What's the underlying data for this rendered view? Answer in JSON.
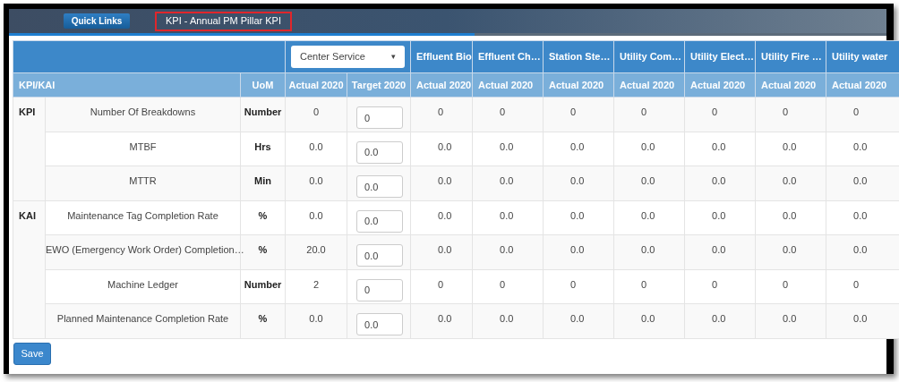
{
  "header": {
    "quick_links": "Quick Links",
    "page_title": "KPI - Annual PM Pillar KPI",
    "title_highlighted": true
  },
  "table": {
    "selector": {
      "value": "Center Service",
      "caret": "▾"
    },
    "site_columns": [
      "Effluent Bio",
      "Effluent Ch…",
      "Station Ste…",
      "Utility Com…",
      "Utility Elect…",
      "Utility Fire …",
      "Utility water"
    ],
    "columns": [
      "KPI/KAI",
      "UoM",
      "Actual 2020",
      "Target 2020",
      "Actual 2020",
      "Actual 2020",
      "Actual 2020",
      "Actual 2020",
      "Actual 2020",
      "Actual 2020",
      "Actual 2020"
    ],
    "groups": [
      {
        "label": "KPI",
        "rows": [
          {
            "name": "Number Of Breakdowns",
            "uom": "Number",
            "actual": "0",
            "target": "0",
            "sites": [
              "0",
              "0",
              "0",
              "0",
              "0",
              "0",
              "0"
            ]
          },
          {
            "name": "MTBF",
            "uom": "Hrs",
            "actual": "0.0",
            "target": "0.0",
            "sites": [
              "0.0",
              "0.0",
              "0.0",
              "0.0",
              "0.0",
              "0.0",
              "0.0"
            ]
          },
          {
            "name": "MTTR",
            "uom": "Min",
            "actual": "0.0",
            "target": "0.0",
            "sites": [
              "0.0",
              "0.0",
              "0.0",
              "0.0",
              "0.0",
              "0.0",
              "0.0"
            ]
          }
        ]
      },
      {
        "label": "KAI",
        "rows": [
          {
            "name": "Maintenance Tag Completion Rate",
            "uom": "%",
            "actual": "0.0",
            "target": "0.0",
            "sites": [
              "0.0",
              "0.0",
              "0.0",
              "0.0",
              "0.0",
              "0.0",
              "0.0"
            ]
          },
          {
            "name": "EWO (Emergency Work Order) Completion…",
            "uom": "%",
            "actual": "20.0",
            "target": "0.0",
            "sites": [
              "0.0",
              "0.0",
              "0.0",
              "0.0",
              "0.0",
              "0.0",
              "0.0"
            ]
          },
          {
            "name": "Machine Ledger",
            "uom": "Number",
            "actual": "2",
            "target": "0",
            "sites": [
              "0",
              "0",
              "0",
              "0",
              "0",
              "0",
              "0"
            ]
          },
          {
            "name": "Planned Maintenance Completion Rate",
            "uom": "%",
            "actual": "0.0",
            "target": "0.0",
            "sites": [
              "0.0",
              "0.0",
              "0.0",
              "0.0",
              "0.0",
              "0.0",
              "0.0"
            ]
          }
        ]
      }
    ]
  },
  "save_button": "Save"
}
